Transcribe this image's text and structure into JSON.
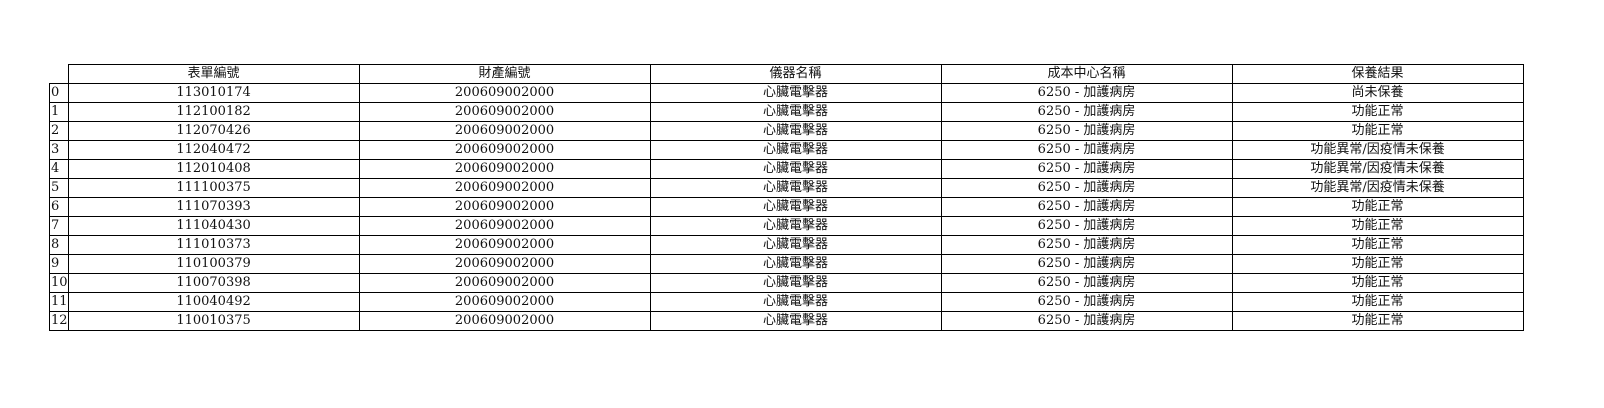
{
  "table": {
    "index_header": "",
    "columns": [
      "表單編號",
      "財產編號",
      "儀器名稱",
      "成本中心名稱",
      "保養結果"
    ],
    "rows": [
      {
        "index": "0",
        "cells": [
          "113010174",
          "200609002000",
          "心臟電擊器",
          "6250 -  加護病房",
          "尚未保養"
        ]
      },
      {
        "index": "1",
        "cells": [
          "112100182",
          "200609002000",
          "心臟電擊器",
          "6250 -  加護病房",
          "功能正常"
        ]
      },
      {
        "index": "2",
        "cells": [
          "112070426",
          "200609002000",
          "心臟電擊器",
          "6250 -  加護病房",
          "功能正常"
        ]
      },
      {
        "index": "3",
        "cells": [
          "112040472",
          "200609002000",
          "心臟電擊器",
          "6250 -  加護病房",
          "功能異常/因疫情未保養"
        ]
      },
      {
        "index": "4",
        "cells": [
          "112010408",
          "200609002000",
          "心臟電擊器",
          "6250 -  加護病房",
          "功能異常/因疫情未保養"
        ]
      },
      {
        "index": "5",
        "cells": [
          "111100375",
          "200609002000",
          "心臟電擊器",
          "6250 -  加護病房",
          "功能異常/因疫情未保養"
        ]
      },
      {
        "index": "6",
        "cells": [
          "111070393",
          "200609002000",
          "心臟電擊器",
          "6250 -  加護病房",
          "功能正常"
        ]
      },
      {
        "index": "7",
        "cells": [
          "111040430",
          "200609002000",
          "心臟電擊器",
          "6250 -  加護病房",
          "功能正常"
        ]
      },
      {
        "index": "8",
        "cells": [
          "111010373",
          "200609002000",
          "心臟電擊器",
          "6250 -  加護病房",
          "功能正常"
        ]
      },
      {
        "index": "9",
        "cells": [
          "110100379",
          "200609002000",
          "心臟電擊器",
          "6250 -  加護病房",
          "功能正常"
        ]
      },
      {
        "index": "10",
        "cells": [
          "110070398",
          "200609002000",
          "心臟電擊器",
          "6250 -  加護病房",
          "功能正常"
        ]
      },
      {
        "index": "11",
        "cells": [
          "110040492",
          "200609002000",
          "心臟電擊器",
          "6250 -  加護病房",
          "功能正常"
        ]
      },
      {
        "index": "12",
        "cells": [
          "110010375",
          "200609002000",
          "心臟電擊器",
          "6250 -  加護病房",
          "功能正常"
        ]
      }
    ]
  }
}
